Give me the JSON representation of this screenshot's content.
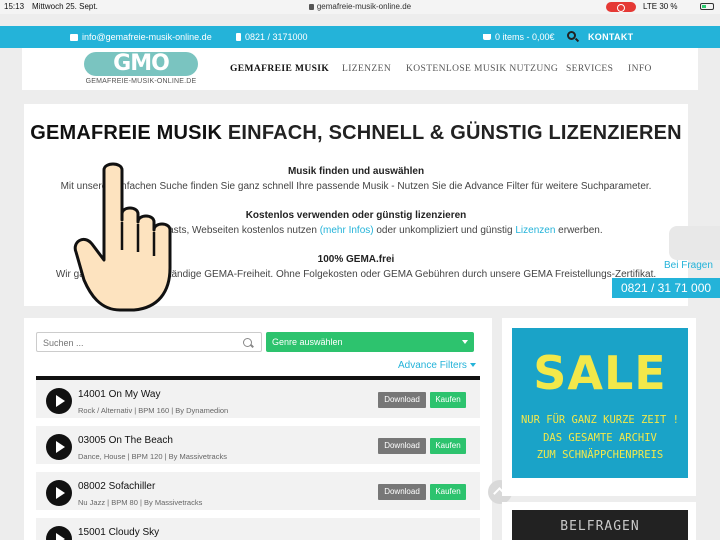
{
  "status_bar": {
    "time": "15:13",
    "date": "Mittwoch 25. Sept.",
    "url": "gemafreie-musik-online.de",
    "carrier": "LTE",
    "battery": "30 %"
  },
  "topbar": {
    "email": "info@gemafreie-musik-online.de",
    "phone": "0821 / 3171000",
    "cart": "0 items - 0,00€",
    "contact_label": "KONTAKT"
  },
  "header": {
    "logo_text": "GMO",
    "logo_sub": "GEMAFREIE-MUSIK-ONLINE.DE",
    "nav": [
      "GEMAFREIE MUSIK",
      "LIZENZEN",
      "KOSTENLOSE MUSIK NUTZUNG",
      "SERVICES",
      "INFO"
    ]
  },
  "hero": {
    "title_a": "GEMAFREIE MUSIK",
    "title_b": "EINFACH, SCHNELL & GÜNSTIG LIZENZIEREN",
    "h1": "Musik finden und auswählen",
    "p1": "Mit unserer einfachen Suche finden Sie ganz schnell Ihre passende Musik - Nutzen Sie die Advance Filter für weitere Suchparameter.",
    "h2": "Kostenlos verwenden oder günstig lizenzieren",
    "p2_pre": "Videos, Podcasts, Webseiten kostenlos nutzen",
    "p2_link1": "(mehr Infos)",
    "p2_mid": "oder unkompliziert und günstig",
    "p2_link2": "Lizenzen",
    "p2_post": "erwerben.",
    "h3": "100% GEMA.frei",
    "p3": "Wir garantieren eine vollständige GEMA-Freiheit. Ohne Folgekosten oder GEMA Gebühren durch unsere GEMA Freistellungs-Zertifikat."
  },
  "side_contact": {
    "question": "Bei Fragen",
    "phone": "0821 / 31 71 000"
  },
  "music": {
    "search_placeholder": "Suchen ...",
    "genre_label": "Genre auswählen",
    "advance_label": "Advance Filters",
    "download_label": "Download",
    "buy_label": "Kaufen",
    "tracks": [
      {
        "title": "14001 On My Way",
        "meta": "Rock / Alternativ | BPM 160 | By Dynamedion"
      },
      {
        "title": "03005 On The Beach",
        "meta": "Dance, House | BPM 120 | By Massivetracks"
      },
      {
        "title": "08002 Sofachiller",
        "meta": "Nu Jazz | BPM 80 | By Massivetracks"
      },
      {
        "title": "15001 Cloudy Sky",
        "meta": ""
      }
    ]
  },
  "sidebar": {
    "sale_big": "SALE",
    "sale_lines": [
      "NUR FÜR GANZ KURZE ZEIT !",
      "DAS GESAMTE ARCHIV",
      "ZUM SCHNÄPPCHENPREIS"
    ],
    "banner2": "BELFRAGEN"
  },
  "colors": {
    "accent": "#24b3d9",
    "green": "#2dc36e",
    "sale_bg": "#1aa3c8",
    "sale_text": "#f2e84a"
  }
}
